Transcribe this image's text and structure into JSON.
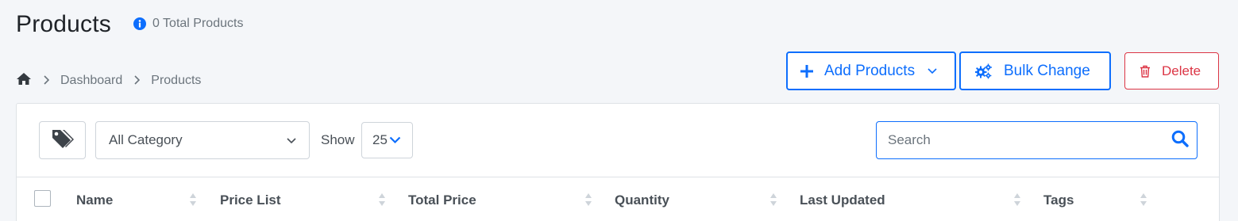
{
  "header": {
    "title": "Products",
    "total_text": "0 Total Products"
  },
  "breadcrumb": {
    "items": [
      "Dashboard",
      "Products"
    ]
  },
  "actions": {
    "add_label": "Add Products",
    "bulk_label": "Bulk Change",
    "delete_label": "Delete"
  },
  "filters": {
    "category_value": "All Category",
    "show_label": "Show",
    "show_value": "25",
    "search_placeholder": "Search"
  },
  "table": {
    "columns": [
      "Name",
      "Price List",
      "Total Price",
      "Quantity",
      "Last Updated",
      "Tags"
    ]
  },
  "colors": {
    "primary": "#0d6efd",
    "danger": "#dc3545",
    "muted": "#6c757d",
    "background": "#f4f6f9"
  }
}
